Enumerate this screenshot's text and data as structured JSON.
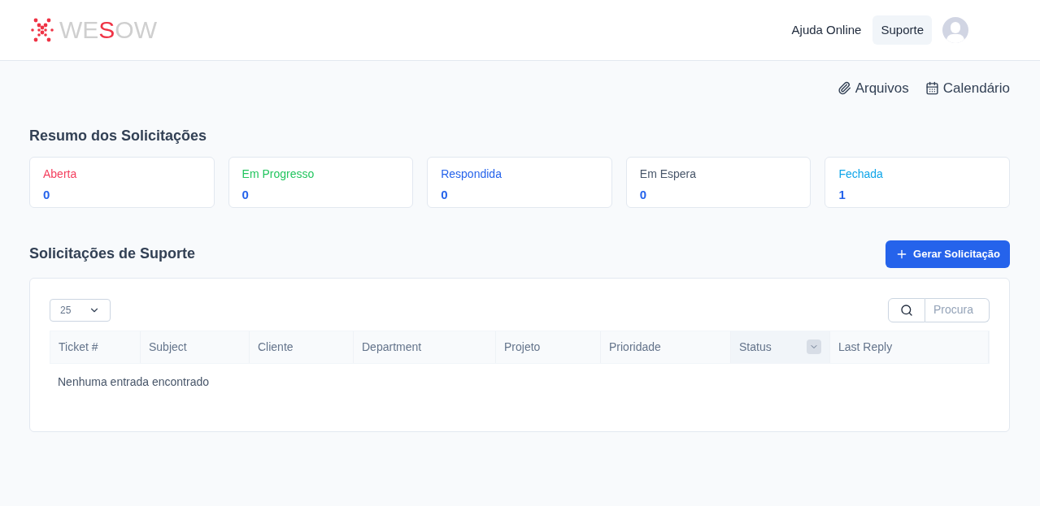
{
  "logo": {
    "parts": [
      {
        "text": "WE",
        "accent": false
      },
      {
        "text": "S",
        "accent": true
      },
      {
        "text": "OW",
        "accent": false
      }
    ]
  },
  "nav": [
    {
      "label": "Ajuda Online",
      "selected": false
    },
    {
      "label": "Suporte",
      "selected": true
    }
  ],
  "quick_links": [
    {
      "kind": "files",
      "label": "Arquivos"
    },
    {
      "kind": "calendar",
      "label": "Calendário"
    }
  ],
  "summary": {
    "title": "Resumo dos Solicitações",
    "cards": [
      {
        "label": "Aberta",
        "count": "0",
        "color": "#f43f5e"
      },
      {
        "label": "Em Progresso",
        "count": "0",
        "color": "#22c55e"
      },
      {
        "label": "Respondida",
        "count": "0",
        "color": "#2563eb"
      },
      {
        "label": "Em Espera",
        "count": "0",
        "color": "#475569"
      },
      {
        "label": "Fechada",
        "count": "1",
        "color": "#0ea5e9"
      }
    ]
  },
  "tickets": {
    "title": "Solicitações de Suporte",
    "button": "Gerar Solicitação",
    "page_size": "25",
    "search_placeholder": "Procura",
    "columns": [
      {
        "label": "Ticket #",
        "sorted": false
      },
      {
        "label": "Subject",
        "sorted": false
      },
      {
        "label": "Cliente",
        "sorted": false
      },
      {
        "label": "Department",
        "sorted": false
      },
      {
        "label": "Projeto",
        "sorted": false
      },
      {
        "label": "Prioridade",
        "sorted": false
      },
      {
        "label": "Status",
        "sorted": true
      },
      {
        "label": "Last Reply",
        "sorted": false
      }
    ],
    "empty": "Nenhuma entrada encontrado"
  }
}
